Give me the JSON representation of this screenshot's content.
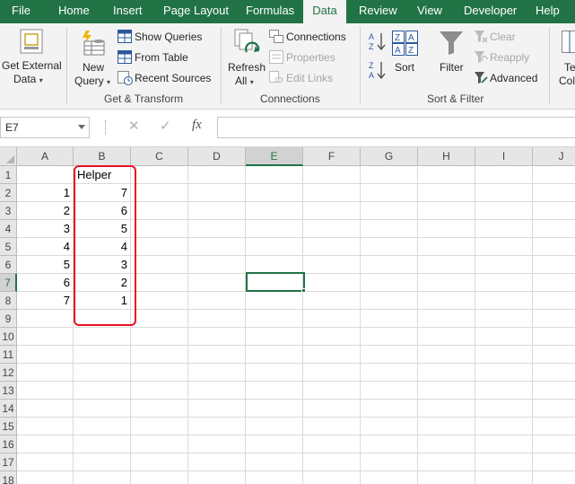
{
  "tabs": [
    {
      "label": "File"
    },
    {
      "label": "Home"
    },
    {
      "label": "Insert"
    },
    {
      "label": "Page Layout"
    },
    {
      "label": "Formulas"
    },
    {
      "label": "Data"
    },
    {
      "label": "Review"
    },
    {
      "label": "View"
    },
    {
      "label": "Developer"
    },
    {
      "label": "Help"
    }
  ],
  "ribbon": {
    "get_external": {
      "line1": "Get External",
      "line2": "Data"
    },
    "new_query": {
      "line1": "New",
      "line2": "Query"
    },
    "show_queries": "Show Queries",
    "from_table": "From Table",
    "recent_sources": "Recent Sources",
    "group_get_transform": "Get & Transform",
    "refresh_all": {
      "line1": "Refresh",
      "line2": "All"
    },
    "connections": "Connections",
    "properties": "Properties",
    "edit_links": "Edit Links",
    "group_connections": "Connections",
    "sort_az": "A↓Z",
    "sort_za": "Z↓A",
    "sort": "Sort",
    "filter": "Filter",
    "clear": "Clear",
    "reapply": "Reapply",
    "advanced": "Advanced",
    "group_sort_filter": "Sort & Filter",
    "text_to_cols": {
      "line1": "Te",
      "line2": "Col"
    }
  },
  "formula_bar": {
    "name_box": "E7",
    "cancel_glyph": "✕",
    "enter_glyph": "✓",
    "fx_label": "fx",
    "formula": ""
  },
  "columns": [
    "A",
    "B",
    "C",
    "D",
    "E",
    "F",
    "G",
    "H",
    "I",
    "J"
  ],
  "rows": [
    "1",
    "2",
    "3",
    "4",
    "5",
    "6",
    "7",
    "8",
    "9",
    "10",
    "11",
    "12",
    "13",
    "14",
    "15",
    "16",
    "17",
    "18"
  ],
  "selected_cell": "E7",
  "sheet": {
    "B1": "Helper",
    "A": [
      "1",
      "2",
      "3",
      "4",
      "5",
      "6",
      "7"
    ],
    "B": [
      "7",
      "6",
      "5",
      "4",
      "3",
      "2",
      "1"
    ]
  },
  "colors": {
    "excel_green": "#217346",
    "highlight_red": "#e81123"
  }
}
